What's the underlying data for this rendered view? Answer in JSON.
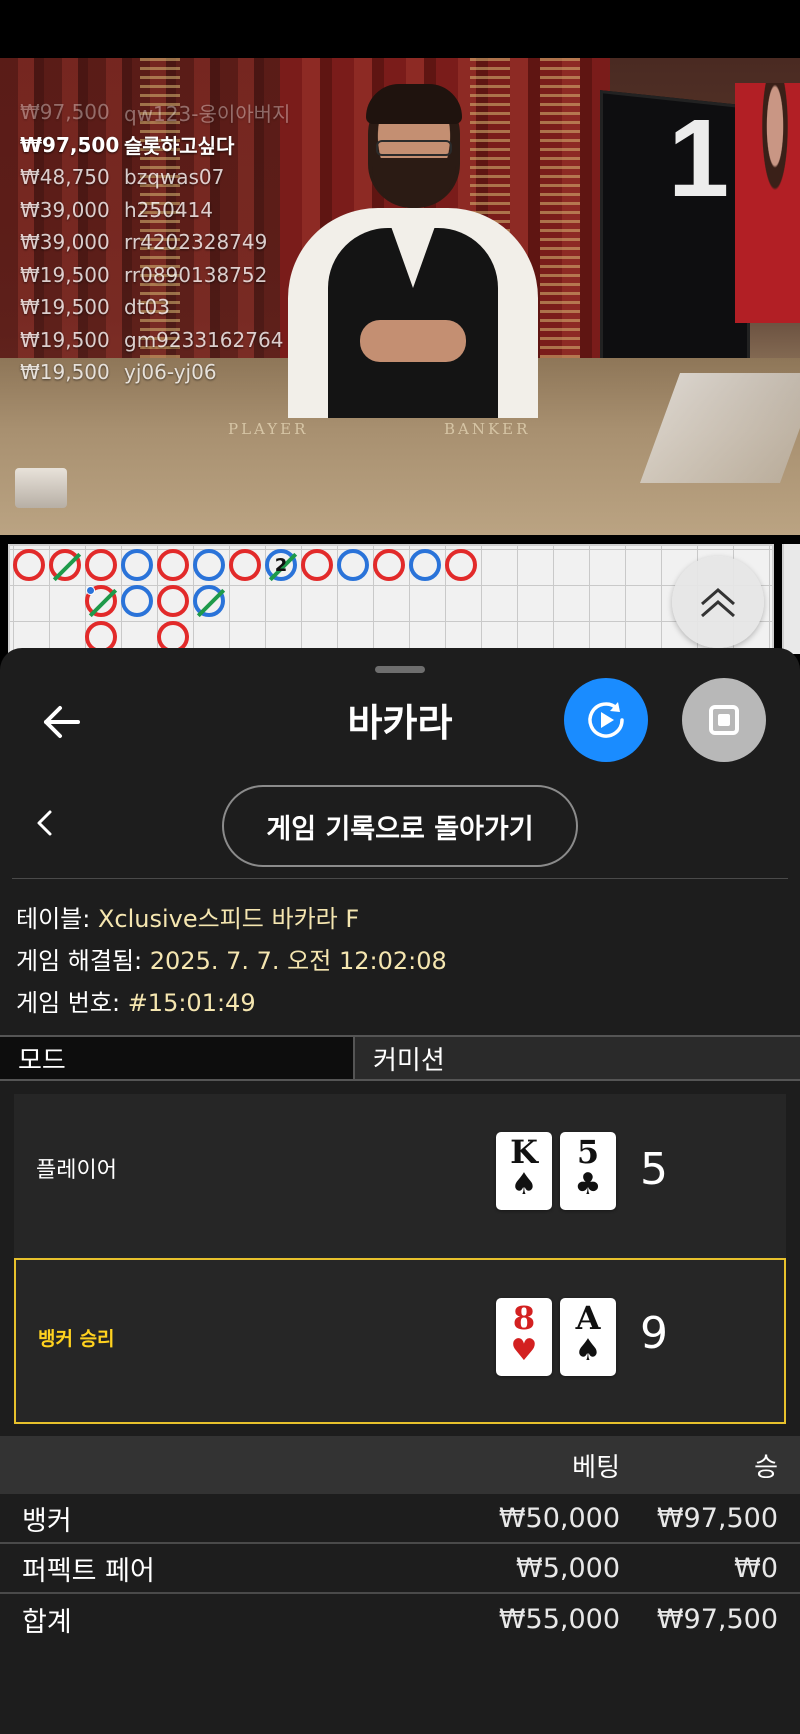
{
  "stream": {
    "round_number": "1",
    "table_labels": [
      "PLAYER",
      "BANKER"
    ],
    "winners": [
      {
        "amount": "₩97,500",
        "user": "qw123-웅이아버지"
      },
      {
        "amount": "₩97,500",
        "user": "슬롯하고싶다"
      },
      {
        "amount": "₩48,750",
        "user": "bzqwas07"
      },
      {
        "amount": "₩39,000",
        "user": "h250414"
      },
      {
        "amount": "₩39,000",
        "user": "rr4202328749"
      },
      {
        "amount": "₩19,500",
        "user": "rr0890138752"
      },
      {
        "amount": "₩19,500",
        "user": "dt03"
      },
      {
        "amount": "₩19,500",
        "user": "gm9233162764"
      },
      {
        "amount": "₩19,500",
        "user": "yj06-yj06"
      }
    ]
  },
  "roadmap": {
    "tie_count_label": "2",
    "colors": {
      "banker": "#e22a2a",
      "player": "#2a73d9",
      "tie": "#1e9a4a"
    }
  },
  "header": {
    "title": "바카라"
  },
  "history_button": "게임 기록으로 돌아가기",
  "info": {
    "table_label": "테이블:",
    "table_value": "Xclusive스피드 바카라 F",
    "resolved_label": "게임 해결됨:",
    "resolved_value": "2025. 7. 7. 오전 12:02:08",
    "game_no_label": "게임 번호:",
    "game_no_value": "#15:01:49"
  },
  "tabs": {
    "mode": "모드",
    "commission": "커미션"
  },
  "result": {
    "player": {
      "label": "플레이어",
      "cards": [
        {
          "rank": "K",
          "suit": "♠"
        },
        {
          "rank": "5",
          "suit": "♣"
        }
      ],
      "score": "5"
    },
    "banker": {
      "label": "뱅커 승리",
      "cards": [
        {
          "rank": "8",
          "suit": "♥"
        },
        {
          "rank": "A",
          "suit": "♠"
        }
      ],
      "score": "9"
    },
    "highlight_color": "#e7c12c"
  },
  "bets": {
    "headers": {
      "bet": "베팅",
      "win": "승"
    },
    "rows": [
      {
        "name": "뱅커",
        "bet": "₩50,000",
        "win": "₩97,500"
      },
      {
        "name": "퍼펙트 페어",
        "bet": "₩5,000",
        "win": "₩0"
      },
      {
        "name": "합계",
        "bet": "₩55,000",
        "win": "₩97,500"
      }
    ]
  }
}
